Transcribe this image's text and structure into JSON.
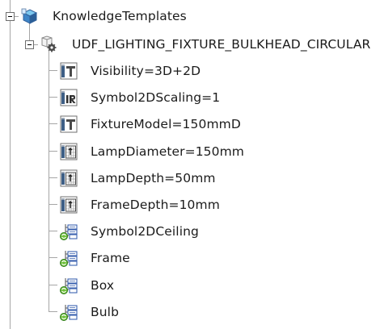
{
  "tree": {
    "root": {
      "label": "KnowledgeTemplates",
      "icon": "knowledge-templates-icon"
    },
    "udf": {
      "label": "UDF_LIGHTING_FIXTURE_BULKHEAD_CIRCULAR",
      "icon": "udf-gear-icon"
    },
    "items": [
      {
        "label": "Visibility=3D+2D",
        "icon": "string-parameter-icon"
      },
      {
        "label": "Symbol2DScaling=1",
        "icon": "real-parameter-icon"
      },
      {
        "label": "FixtureModel=150mmD",
        "icon": "string-parameter-icon"
      },
      {
        "label": "LampDiameter=150mm",
        "icon": "length-parameter-icon"
      },
      {
        "label": "LampDepth=50mm",
        "icon": "length-parameter-icon"
      },
      {
        "label": "FrameDepth=10mm",
        "icon": "length-parameter-icon"
      },
      {
        "label": "Symbol2DCeiling",
        "icon": "formula-relation-icon"
      },
      {
        "label": "Frame",
        "icon": "formula-relation-icon"
      },
      {
        "label": "Box",
        "icon": "formula-relation-icon"
      },
      {
        "label": "Bulb",
        "icon": "formula-relation-icon"
      }
    ]
  }
}
